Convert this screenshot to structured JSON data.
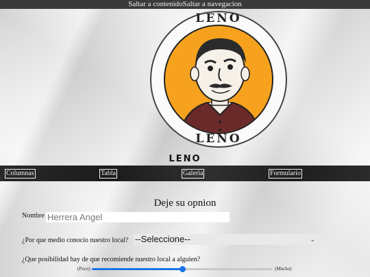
{
  "skip_links": {
    "content": "Saltar a contenido",
    "navigation": "Saltar a navegacion"
  },
  "logo": {
    "top_text": "LENO",
    "bottom_text": "LENO"
  },
  "brand": "LENO",
  "nav": {
    "items": [
      {
        "label": "Columnas"
      },
      {
        "label": "Tabla"
      },
      {
        "label": "Galeria"
      },
      {
        "label": "Formulario"
      }
    ]
  },
  "form": {
    "title": "Deje su opnion",
    "name_label": "Nombre",
    "name_value": "Herrera Angel",
    "medium_label": "¿Por que medio conocio nuestro local?",
    "medium_selected": "--Seleccione--",
    "recommend_label": "¿Que posibilidad hay de que recomiende nuestro local a alguien?",
    "range_min_label": "(Poco)",
    "range_max_label": "(Mucho)",
    "range_value_fraction": 0.5
  },
  "colors": {
    "logo_orange": "#f6a21e",
    "accent_blue": "#1a73e8",
    "nav_bg": "#222222"
  }
}
